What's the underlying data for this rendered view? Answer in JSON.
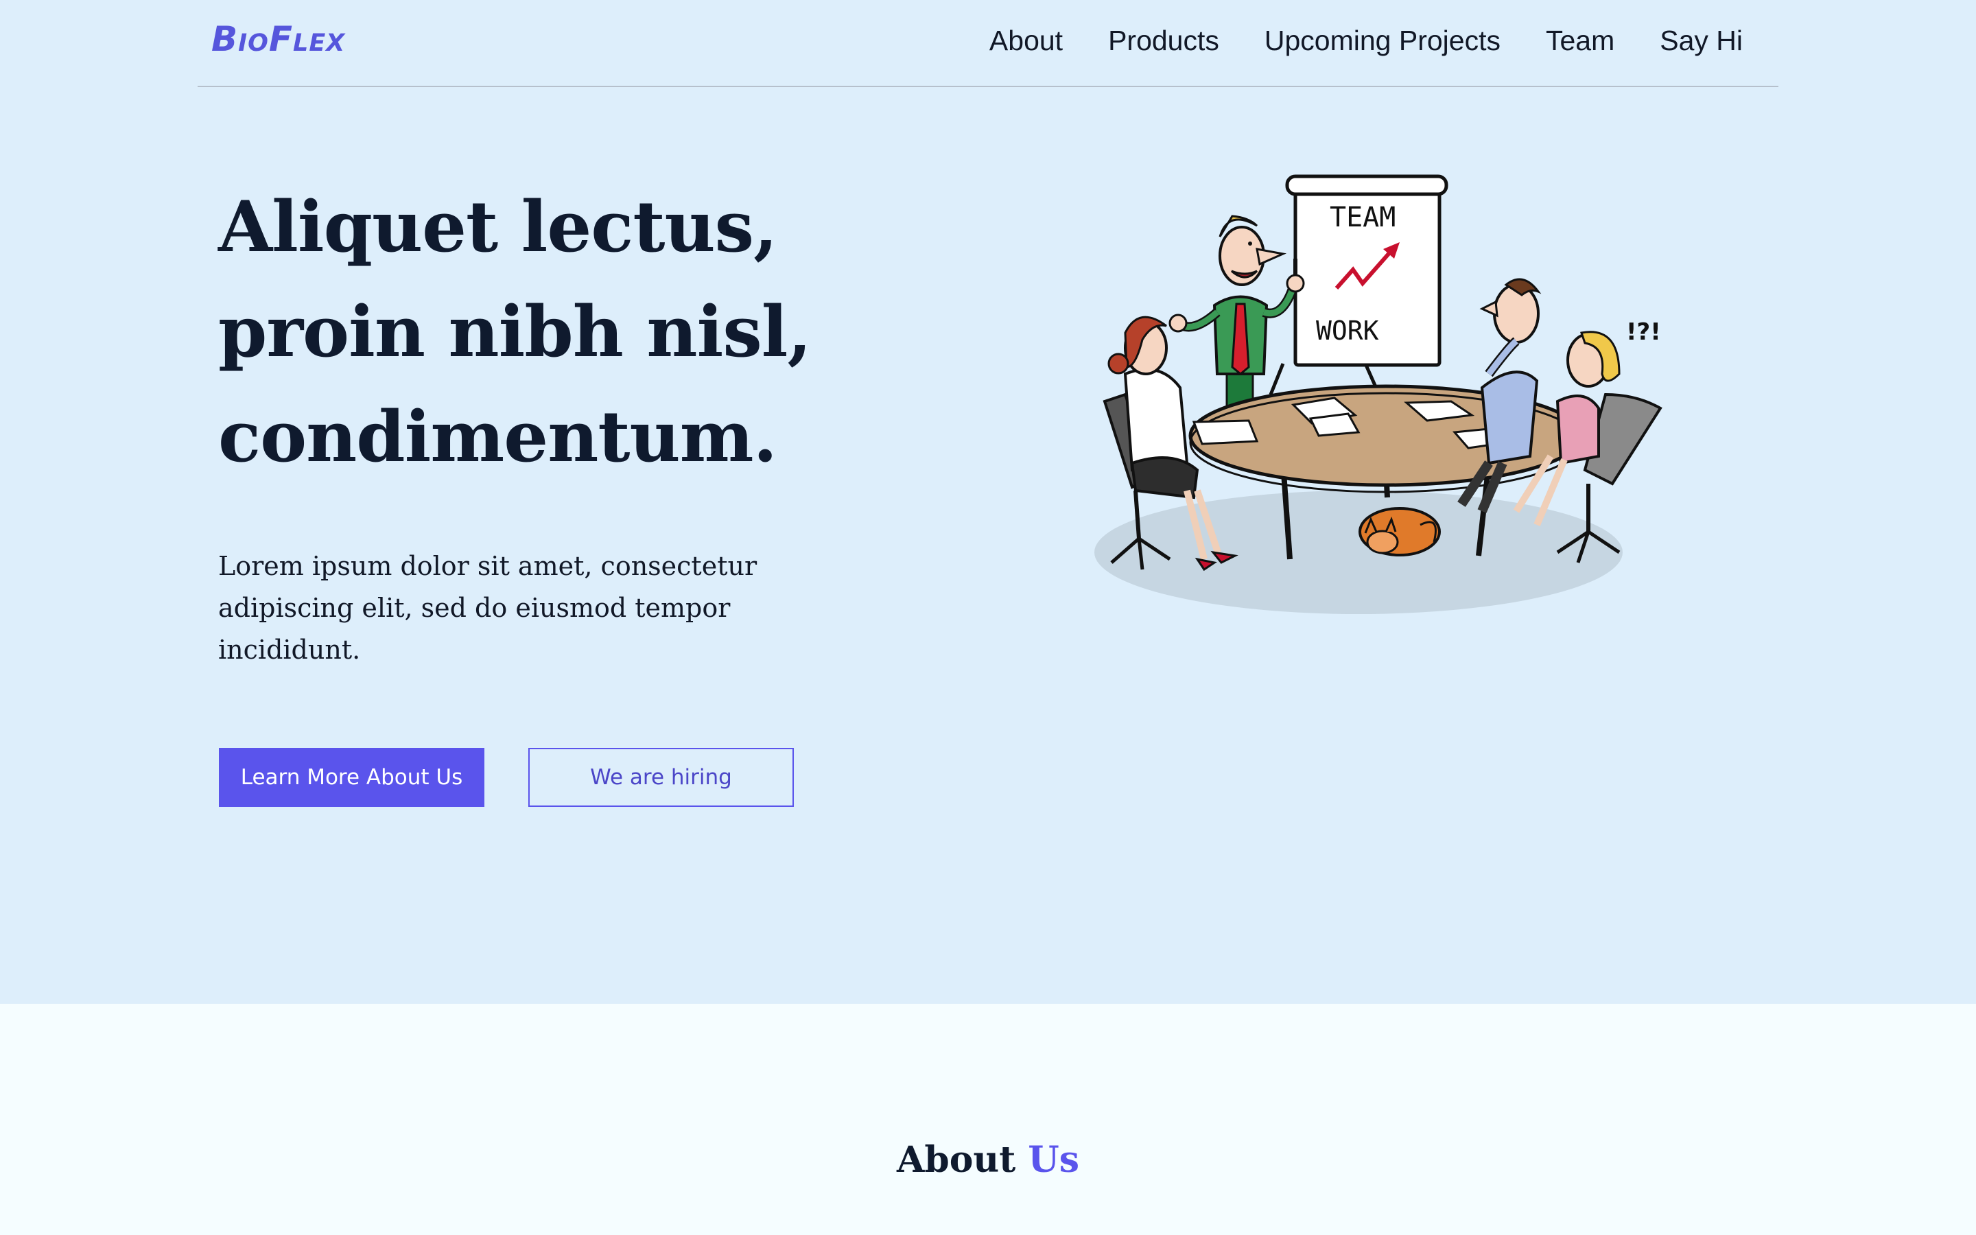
{
  "brand": {
    "logo": "BioFlex",
    "accent_color": "#5a54ec",
    "hero_bg": "#ddeefb"
  },
  "nav": {
    "items": [
      "About",
      "Products",
      "Upcoming Projects",
      "Team",
      "Say Hi"
    ]
  },
  "hero": {
    "headline": "Aliquet lectus, proin nibh nisl, condimentum.",
    "lead": "Lorem ipsum dolor sit amet, consectetur adipiscing elit, sed do eiusmod tempor incididunt.",
    "primary_button": "Learn More About Us",
    "secondary_button": "We are hiring",
    "illustration": {
      "board_top": "TEAM",
      "board_bottom": "WORK",
      "exclaim": "!?!"
    }
  },
  "about": {
    "title_main": "About",
    "title_accent": "Us"
  }
}
